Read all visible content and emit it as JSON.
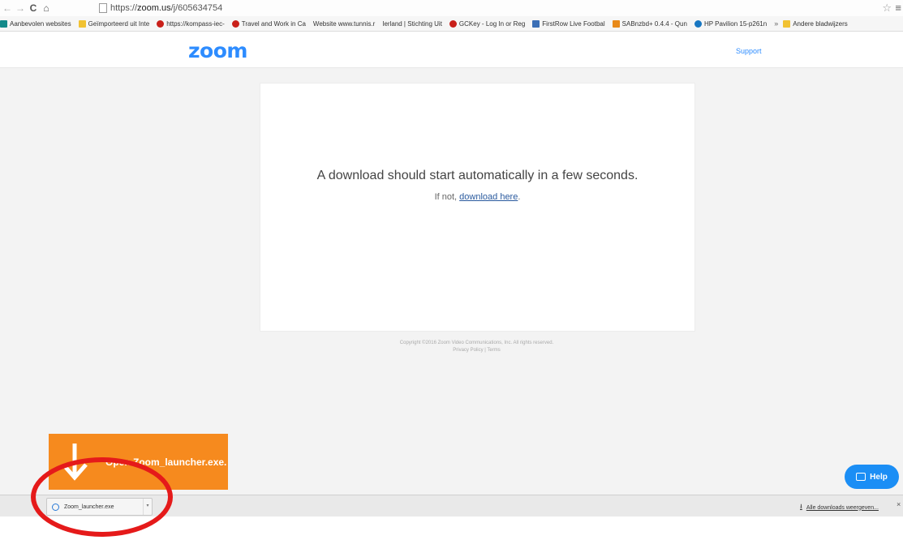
{
  "browser": {
    "url_scheme": "https://",
    "url_host": "zoom.us",
    "url_path": "/j/605634754",
    "bookmarks": [
      {
        "label": "Aanbevolen websites",
        "icon": "bing"
      },
      {
        "label": "Geïmporteerd uit Inte",
        "icon": "folder"
      },
      {
        "label": "https://kompass-iec-",
        "icon": "leaf"
      },
      {
        "label": "Travel and Work in Ca",
        "icon": "leaf"
      },
      {
        "label": "Website www.tunnis.r",
        "icon": "page"
      },
      {
        "label": "Ierland | Stichting Uit",
        "icon": "page"
      },
      {
        "label": "GCKey - Log In or Reg",
        "icon": "leaf"
      },
      {
        "label": "FirstRow Live Footbal",
        "icon": "frow"
      },
      {
        "label": "SABnzbd+ 0.4.4 - Qun",
        "icon": "sab"
      },
      {
        "label": "HP Pavilion 15-p261n",
        "icon": "hp"
      }
    ],
    "bookmarks_more": "»",
    "other_bookmarks": "Andere bladwijzers"
  },
  "site": {
    "logo": "zoom",
    "support_label": "Support",
    "headline": "A download should start automatically in a few seconds.",
    "fallback_prefix": "If not, ",
    "fallback_link": "download here",
    "fallback_suffix": ".",
    "copyright": "Copyright ©2016 Zoom Video Communications, Inc. All rights reserved.",
    "footer_links": "Privacy Policy | Terms",
    "toast_text": "Open Zoom_launcher.exe.",
    "help_label": "Help"
  },
  "download_shelf": {
    "file_name": "Zoom_launcher.exe",
    "show_all_label": "Alle downloads weergeven...",
    "close_label": "×"
  },
  "colors": {
    "brand_blue": "#2d8cff",
    "toast_orange": "#f68a1e",
    "annotation_red": "#e51a1a"
  }
}
